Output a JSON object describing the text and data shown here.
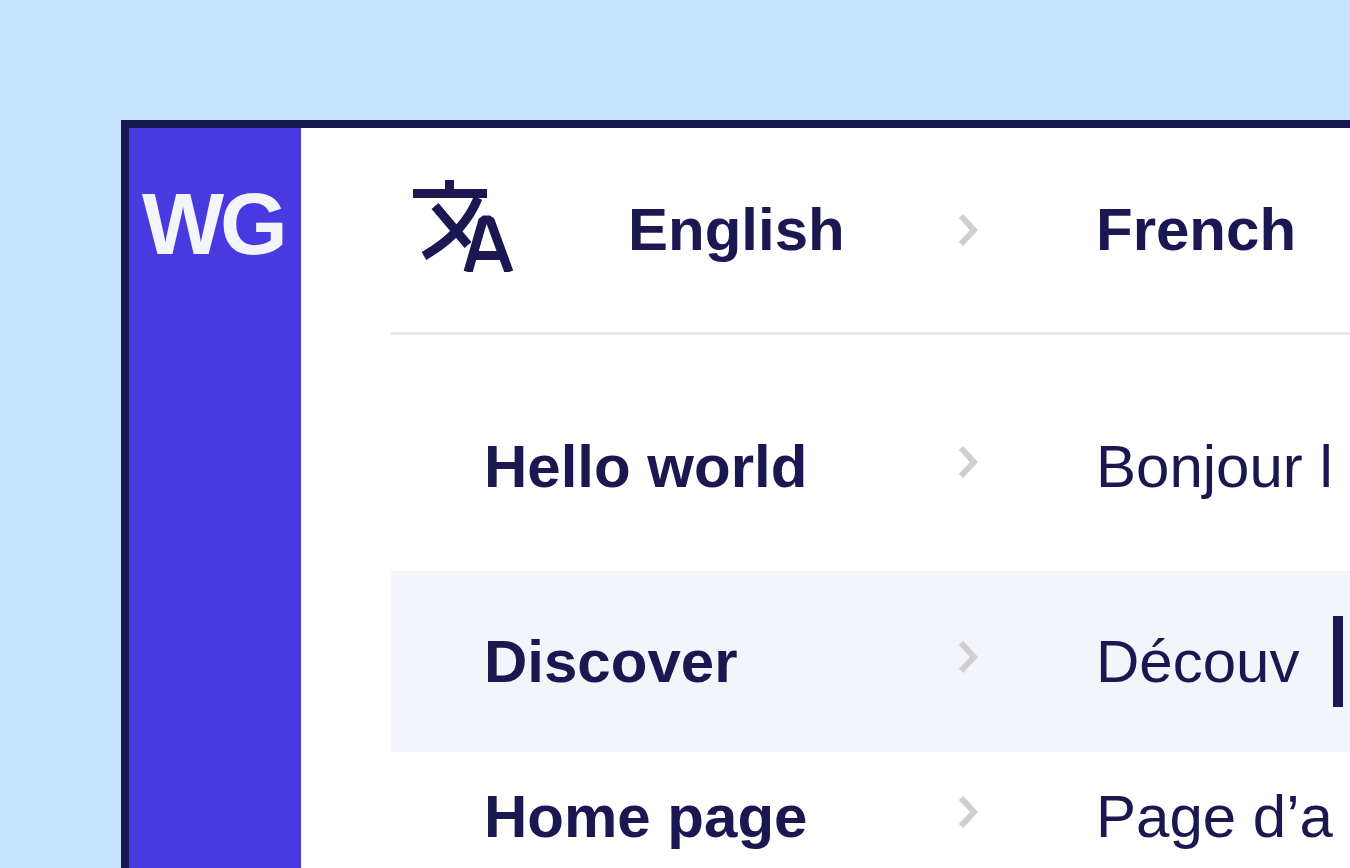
{
  "logo": "WG",
  "header": {
    "source_language": "English",
    "target_language": "French"
  },
  "rows": [
    {
      "source": "Hello world",
      "translation": "Bonjour l",
      "selected": false
    },
    {
      "source": "Discover",
      "translation": "Découv",
      "selected": true
    },
    {
      "source": "Home page",
      "translation": "Page d’a",
      "selected": false
    }
  ]
}
